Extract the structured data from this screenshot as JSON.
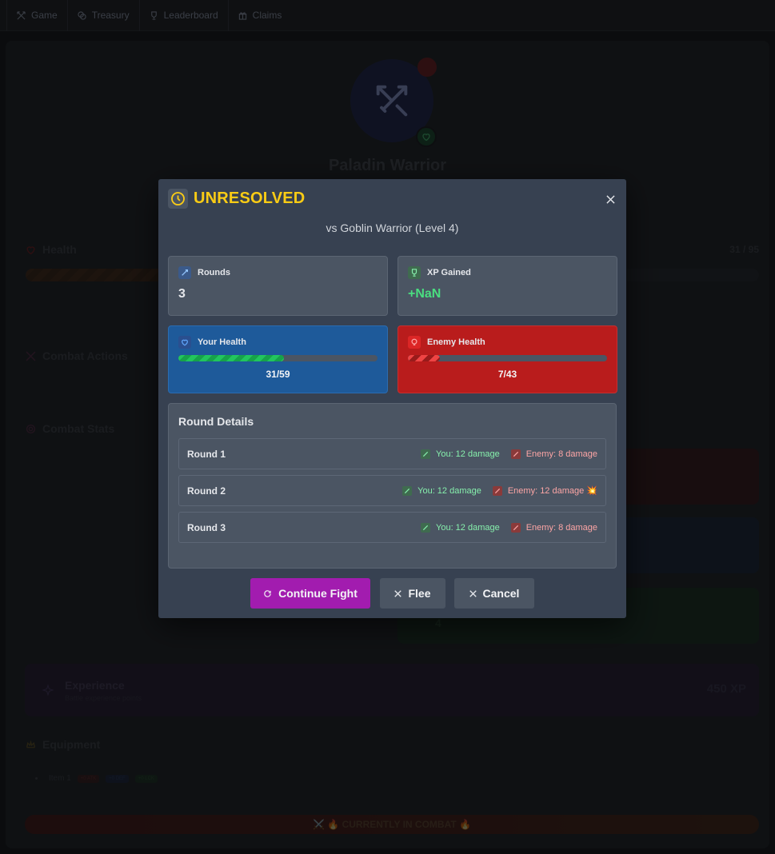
{
  "nav": {
    "tabs": [
      {
        "label": "Game",
        "icon": "swords-icon"
      },
      {
        "label": "Treasury",
        "icon": "coins-icon"
      },
      {
        "label": "Leaderboard",
        "icon": "trophy-icon"
      },
      {
        "label": "Claims",
        "icon": "gift-icon"
      }
    ]
  },
  "background": {
    "character_name": "Paladin Warrior",
    "health_label": "Health",
    "health_value": "31 / 95",
    "health_fraction": 0.33,
    "combat_actions_label": "Combat Actions",
    "combat_stats_label": "Combat Stats",
    "stat_card_value": "4",
    "experience": {
      "title": "Experience",
      "subtitle": "Battle experience points",
      "value": "450 XP"
    },
    "equipment_label": "Equipment",
    "equipment_items": [
      {
        "name": "Item 1",
        "badges": [
          "+0 ATK",
          "+0 DEF",
          "+0 LCK"
        ]
      }
    ],
    "combat_banner": "⚔️ 🔥 CURRENTLY IN COMBAT 🔥"
  },
  "modal": {
    "status": "UNRESOLVED",
    "opponent": "vs Goblin Warrior (Level 4)",
    "rounds": {
      "label": "Rounds",
      "value": "3"
    },
    "xp": {
      "label": "XP Gained",
      "value": "+NaN"
    },
    "your_health": {
      "label": "Your Health",
      "text": "31/59",
      "fraction": 0.53
    },
    "enemy_health": {
      "label": "Enemy Health",
      "text": "7/43",
      "fraction": 0.16
    },
    "round_details_title": "Round Details",
    "round_list": [
      {
        "label": "Round 1",
        "you": "You: 12 damage",
        "enemy": "Enemy: 8 damage"
      },
      {
        "label": "Round 2",
        "you": "You: 12 damage",
        "enemy": "Enemy: 12 damage 💥"
      },
      {
        "label": "Round 3",
        "you": "You: 12 damage",
        "enemy": "Enemy: 8 damage"
      }
    ],
    "buttons": {
      "continue": "Continue Fight",
      "flee": "Flee",
      "cancel": "Cancel"
    }
  },
  "colors": {
    "status": "#facc15",
    "primary_button": "#a21caf",
    "your_health_card": "#1e5a9a",
    "enemy_health_card": "#b91c1c",
    "xp_text": "#4ade80"
  }
}
